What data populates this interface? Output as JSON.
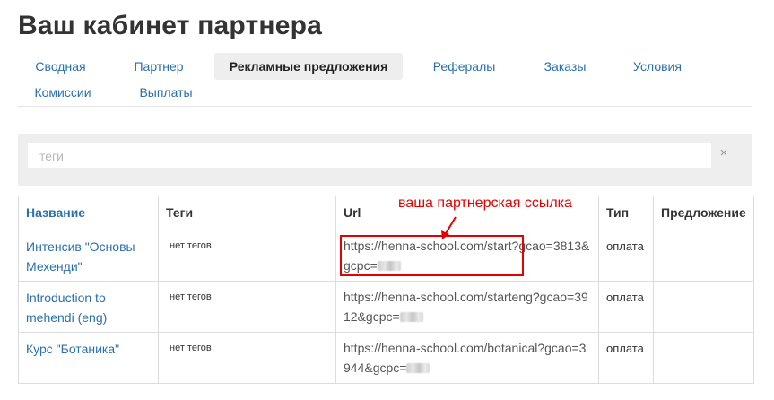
{
  "page": {
    "title": "Ваш кабинет партнера"
  },
  "tabs": [
    {
      "label": "Сводная"
    },
    {
      "label": "Партнер"
    },
    {
      "label": "Рекламные предложения"
    },
    {
      "label": "Рефералы"
    },
    {
      "label": "Заказы"
    },
    {
      "label": "Условия"
    },
    {
      "label": "Комиссии"
    },
    {
      "label": "Выплаты"
    }
  ],
  "active_tab": "Рекламные предложения",
  "filter": {
    "placeholder": "теги",
    "value": "",
    "clear_symbol": "×"
  },
  "table": {
    "headers": [
      "Название",
      "Теги",
      "Url",
      "Тип",
      "Предложение"
    ],
    "rows": [
      {
        "name": "Интенсив \"Основы Мехенди\"",
        "tags": "нет тегов",
        "url": "https://henna-school.com/start?gcao=3813&gcpc=",
        "type": "оплата",
        "offer": ""
      },
      {
        "name": "Introduction to mehendi (eng)",
        "tags": "нет тегов",
        "url": "https://henna-school.com/starteng?gcao=3912&gcpc=",
        "type": "оплата",
        "offer": ""
      },
      {
        "name": "Курс \"Ботаника\"",
        "tags": "нет тегов",
        "url": "https://henna-school.com/botanical?gcao=3944&gcpc=",
        "type": "оплата",
        "offer": ""
      }
    ]
  },
  "annotation": {
    "text": "ваша партнерская ссылка",
    "color": "#e60000"
  },
  "colors": {
    "link": "#2a6fae",
    "active_tab_bg": "#eeeeee",
    "filter_bg": "#eeeeee",
    "border": "#dddddd"
  }
}
